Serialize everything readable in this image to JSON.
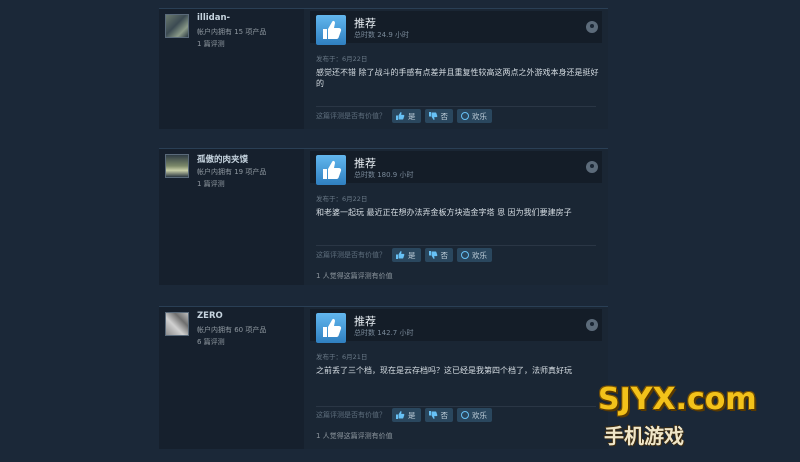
{
  "reviews": [
    {
      "username": "illidan-",
      "owned": "帐户内拥有 15 项产品",
      "count": "1 篇评测",
      "verdict": "推荐",
      "hours": "总时数 24.9 小时",
      "posted": "发布于：6月22日",
      "text": "感觉还不错 除了战斗的手感有点差并且重复性较高这两点之外游戏本身还是挺好的",
      "helpful_question": "这篇评测是否有价值？",
      "yes_label": "是",
      "no_label": "否",
      "funny_label": "欢乐",
      "found_helpful": ""
    },
    {
      "username": "孤傲的肉夹馍",
      "owned": "帐户内拥有 19 项产品",
      "count": "1 篇评测",
      "verdict": "推荐",
      "hours": "总时数 180.9 小时",
      "posted": "发布于：6月22日",
      "text": "和老婆一起玩 最近正在想办法弄金板方块造金字塔 恩 因为我们要建房子",
      "helpful_question": "这篇评测是否有价值？",
      "yes_label": "是",
      "no_label": "否",
      "funny_label": "欢乐",
      "found_helpful": "1 人觉得这篇评测有价值"
    },
    {
      "username": "ZERO",
      "owned": "帐户内拥有 60 项产品",
      "count": "6 篇评测",
      "verdict": "推荐",
      "hours": "总时数 142.7 小时",
      "posted": "发布于：6月21日",
      "text": "之前丢了三个档，现在是云存档吗？这已经是我第四个档了，法师真好玩",
      "helpful_question": "这篇评测是否有价值？",
      "yes_label": "是",
      "no_label": "否",
      "funny_label": "欢乐",
      "found_helpful": "1 人觉得这篇评测有价值"
    }
  ],
  "watermark": {
    "main": "SJYX.com",
    "sub": "手机游戏"
  },
  "colors": {
    "background": "#1b2838",
    "card": "#1a2634",
    "thumb_blue": "#4fa3e0",
    "button": "#2a475e"
  }
}
